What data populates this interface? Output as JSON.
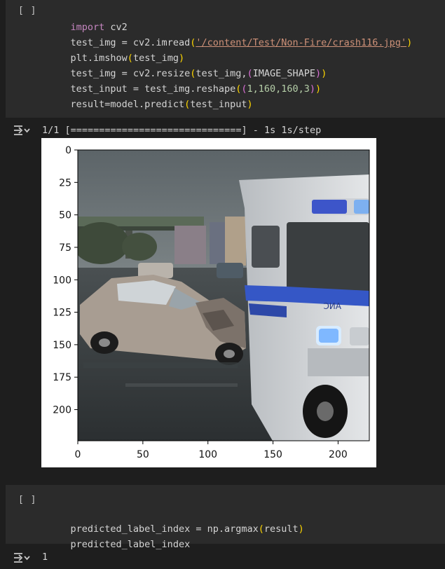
{
  "cells": [
    {
      "run_label": "[ ]",
      "lines": [
        [
          "import",
          " cv2"
        ],
        [
          "test_img = cv2.imread",
          "(",
          "'/content/Test/Non-Fire/crash116.jpg'",
          ")"
        ],
        [
          "plt.imshow",
          "(",
          "test_img",
          ")"
        ],
        [
          "test_img = cv2.resize",
          "(",
          "test_img,",
          "(",
          "IMAGE_SHAPE",
          ")",
          ")"
        ],
        [
          "test_input = test_img.reshape",
          "(",
          "(",
          "1,160,160,3",
          ")",
          ")"
        ],
        [
          "result=model.predict",
          "(",
          "test_input",
          ")"
        ]
      ]
    },
    {
      "run_label": "[ ]",
      "lines": [
        [
          "predicted_label_index = np.argmax",
          "(",
          "result",
          ")"
        ],
        [
          "predicted_label_index"
        ]
      ]
    }
  ],
  "outputs": {
    "progress": "1/1 [==============================] - 1s 1s/step",
    "result": "1"
  },
  "chart_data": {
    "type": "image",
    "xticks": [
      0,
      50,
      100,
      150,
      200
    ],
    "yticks": [
      0,
      25,
      50,
      75,
      100,
      125,
      150,
      175,
      200
    ],
    "xlim": [
      0,
      224
    ],
    "ylim": [
      224,
      0
    ]
  },
  "colors": {
    "cell_bg": "#2b2b2b",
    "page_bg": "#1e1e1e",
    "keyword": "#c586c0",
    "string": "#ce9178",
    "number": "#b5cea8"
  }
}
